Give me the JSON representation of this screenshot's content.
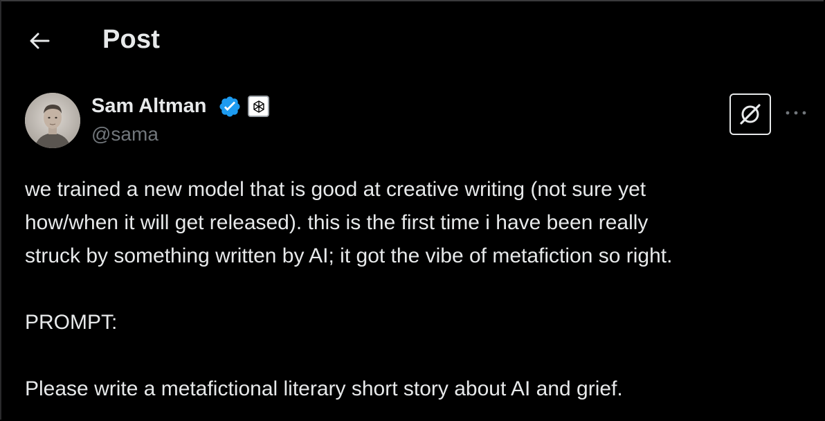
{
  "header": {
    "back_icon": "arrow-left-icon",
    "title": "Post"
  },
  "author": {
    "name": "Sam Altman",
    "handle": "@sama",
    "verified_icon": "verified-badge-icon",
    "verified_color": "#1d9bf0",
    "affiliate_icon": "openai-logo-icon",
    "avatar": "profile-photo"
  },
  "actions": {
    "grok_icon": "grok-icon",
    "more_icon": "more-horizontal-icon"
  },
  "post": {
    "lines": [
      "we trained a new model that is good at creative writing (not sure yet",
      "how/when it will get released). this is the first time i have been really",
      "struck by something written by AI; it got the vibe of metafiction so right."
    ],
    "prompt_label": "PROMPT:",
    "prompt_text": "Please write a metafictional literary short story about AI and grief."
  },
  "colors": {
    "background": "#000000",
    "text_primary": "#e7e9ea",
    "text_secondary": "#71767b"
  }
}
